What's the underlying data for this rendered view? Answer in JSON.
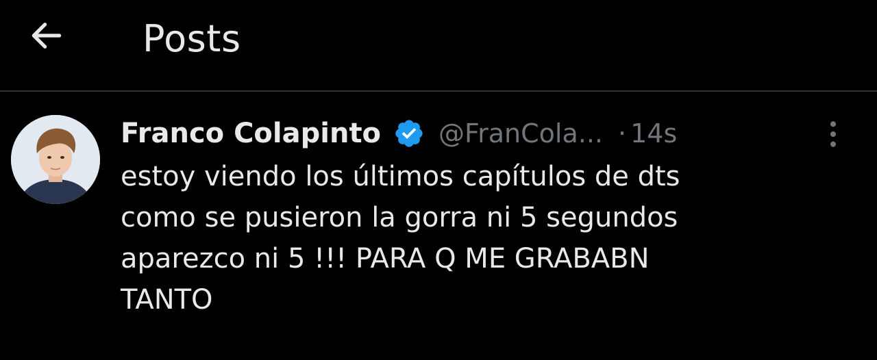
{
  "header": {
    "back_icon": "arrow-left-icon",
    "title": "Posts"
  },
  "post": {
    "author": {
      "name": "Franco Colapinto",
      "verified_icon": "verified-badge-icon",
      "handle": "@FranCola...",
      "separator": "·",
      "timestamp": "14s",
      "avatar_icon": "profile-photo"
    },
    "text_lines": [
      "estoy viendo los últimos capítulos de dts",
      "como se pusieron la gorra ni 5 segundos",
      "aparezco ni 5 !!! PARA Q ME GRABABN",
      "TANTO"
    ],
    "more_icon": "more-vertical-icon"
  },
  "colors": {
    "background": "#000000",
    "text_primary": "#e7e9ea",
    "text_secondary": "#71767b",
    "verified_blue": "#1d9bf0",
    "divider": "#2f3336"
  }
}
